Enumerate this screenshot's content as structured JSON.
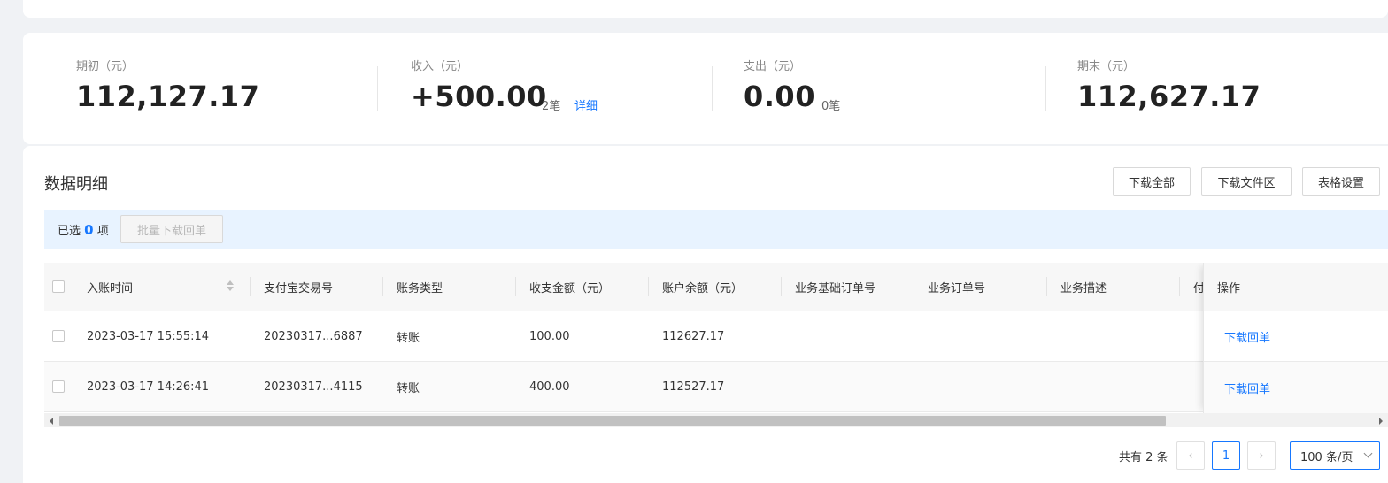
{
  "summary": {
    "opening": {
      "label": "期初（元）",
      "value": "112,127.17"
    },
    "income": {
      "label": "收入（元）",
      "value": "+500.00",
      "count": "2笔",
      "detail_link": "详细"
    },
    "expense": {
      "label": "支出（元）",
      "value": "0.00",
      "count": "0笔"
    },
    "closing": {
      "label": "期末（元）",
      "value": "112,627.17"
    }
  },
  "section": {
    "title": "数据明细",
    "buttons": {
      "download_all": "下载全部",
      "download_files": "下载文件区",
      "table_settings": "表格设置"
    }
  },
  "selection": {
    "prefix": "已选",
    "count": "0",
    "suffix": "项",
    "batch_button": "批量下载回单"
  },
  "table": {
    "columns": [
      "入账时间",
      "支付宝交易号",
      "账务类型",
      "收支金额（元）",
      "账户余额（元）",
      "业务基础订单号",
      "业务订单号",
      "业务描述",
      "付"
    ],
    "action_header": "操作",
    "rows": [
      {
        "time": "2023-03-17 15:55:14",
        "trade_no": "20230317...6887",
        "type": "转账",
        "amount": "100.00",
        "balance": "112627.17",
        "action": "下载回单"
      },
      {
        "time": "2023-03-17 14:26:41",
        "trade_no": "20230317...4115",
        "type": "转账",
        "amount": "400.00",
        "balance": "112527.17",
        "action": "下载回单"
      }
    ]
  },
  "pagination": {
    "total": "共有 2 条",
    "prev": "‹",
    "current": "1",
    "next": "›",
    "page_size": "100 条/页"
  },
  "colors": {
    "accent": "#1677ff",
    "selection_bg": "#e8f3ff"
  }
}
